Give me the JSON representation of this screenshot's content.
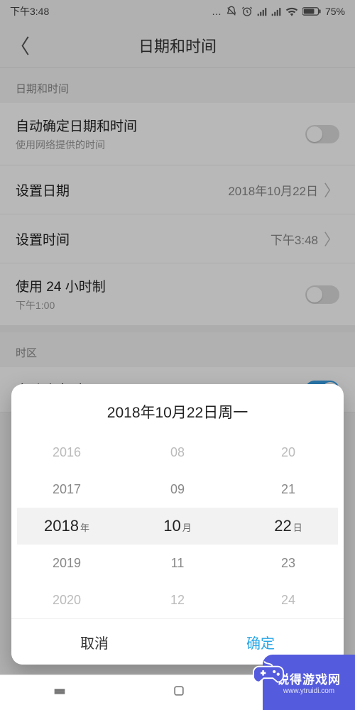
{
  "status": {
    "time": "下午3:48",
    "battery": "75%"
  },
  "header": {
    "title": "日期和时间"
  },
  "sections": {
    "datetime_header": "日期和时间",
    "timezone_header": "时区"
  },
  "rows": {
    "auto_datetime": {
      "title": "自动确定日期和时间",
      "sub": "使用网络提供的时间",
      "on": false
    },
    "set_date": {
      "title": "设置日期",
      "value": "2018年10月22日"
    },
    "set_time": {
      "title": "设置时间",
      "value": "下午3:48"
    },
    "use_24h": {
      "title": "使用 24 小时制",
      "sub": "下午1:00",
      "on": false
    },
    "auto_tz": {
      "title": "自动确定时区",
      "on": true
    }
  },
  "picker": {
    "title": "2018年10月22日周一",
    "year": {
      "unit": "年",
      "opts": [
        "2016",
        "2017",
        "2018",
        "2019",
        "2020"
      ],
      "sel": 2
    },
    "month": {
      "unit": "月",
      "opts": [
        "08",
        "09",
        "10",
        "11",
        "12"
      ],
      "sel": 2
    },
    "day": {
      "unit": "日",
      "opts": [
        "20",
        "21",
        "22",
        "23",
        "24"
      ],
      "sel": 2
    },
    "cancel": "取消",
    "ok": "确定"
  },
  "watermark": {
    "line1": "锐得游戏网",
    "line2": "www.ytruidi.com"
  }
}
